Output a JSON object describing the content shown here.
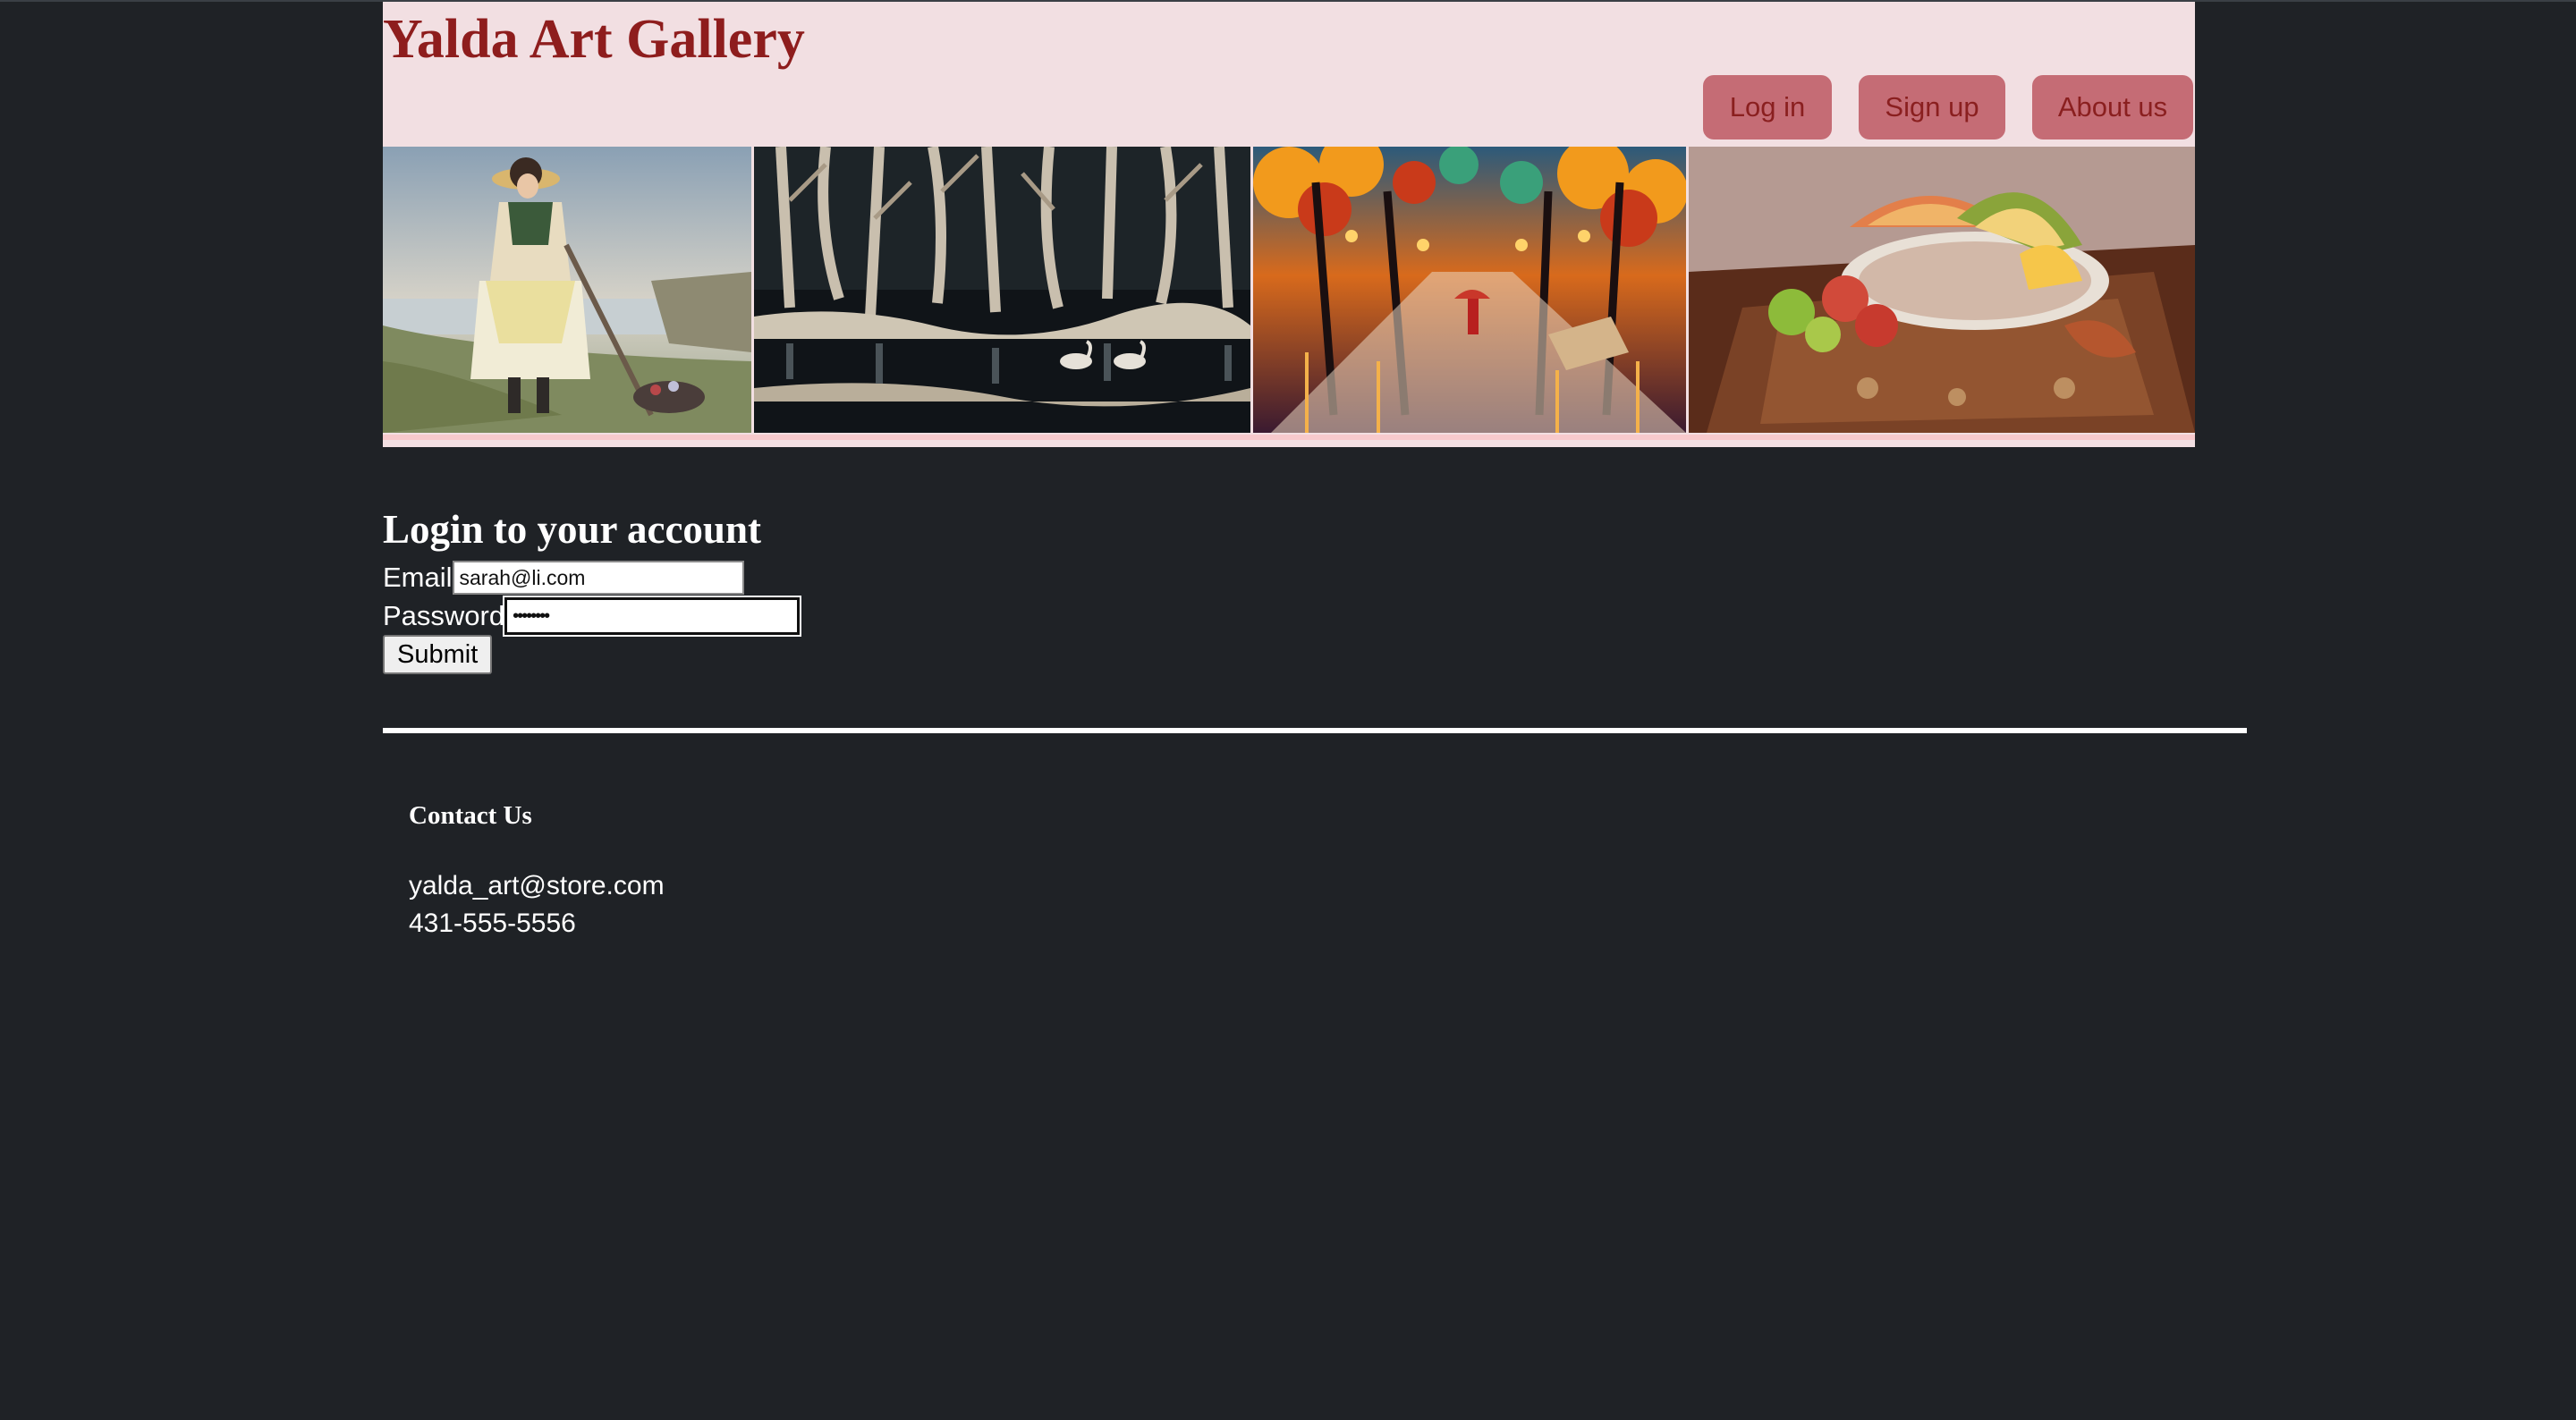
{
  "header": {
    "title": "Yalda Art Gallery",
    "nav": [
      {
        "label": "Log in"
      },
      {
        "label": "Sign up"
      },
      {
        "label": "About us"
      }
    ]
  },
  "banner": {
    "paintings": [
      {
        "subject": "woman-by-the-sea"
      },
      {
        "subject": "birch-forest-with-swans"
      },
      {
        "subject": "autumn-park-in-rain"
      },
      {
        "subject": "melon-still-life"
      }
    ]
  },
  "login": {
    "heading": "Login to your account",
    "email_label": "Email",
    "email_value": "sarah@li.com",
    "password_label": "Password",
    "password_value": "••••••••",
    "submit_label": "Submit"
  },
  "contact": {
    "heading": "Contact Us",
    "email": "yalda_art@store.com",
    "phone": "431-555-5556"
  },
  "colors": {
    "page_bg": "#1f2226",
    "header_bg": "#f2dfe2",
    "title": "#8e1d1d",
    "nav_button_bg": "#c56c75",
    "nav_button_text": "#8a1f1f"
  }
}
